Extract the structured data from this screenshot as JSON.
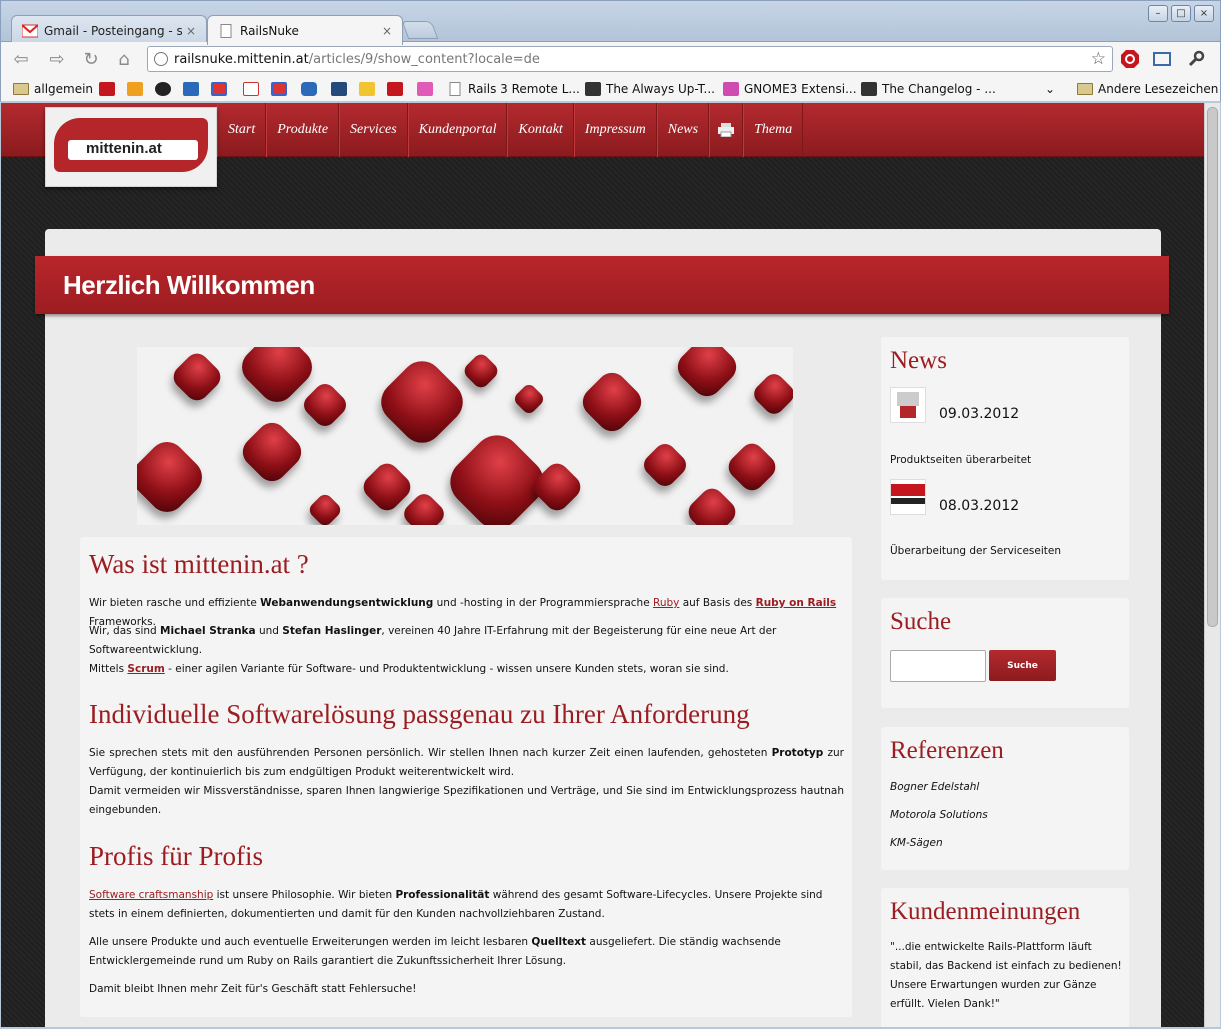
{
  "browser": {
    "tabs": [
      {
        "title": "Gmail - Posteingang - stefa",
        "active": false,
        "icon": "gmail-icon"
      },
      {
        "title": "RailsNuke",
        "active": true,
        "icon": "page-icon"
      }
    ],
    "close_glyph": "×",
    "url_host": "railsnuke.mittenin.at",
    "url_path": "/articles/9/show_content?locale=de",
    "window_buttons": [
      "–",
      "□",
      "×"
    ],
    "bookmarks": [
      {
        "label": "allgemein",
        "icon": "folder-icon"
      },
      {
        "label": "Rails 3 Remote L...",
        "icon": "page-icon"
      },
      {
        "label": "The Always Up-T...",
        "icon": "site-icon"
      },
      {
        "label": "GNOME3 Extensi...",
        "icon": "gnome-icon"
      },
      {
        "label": "The Changelog - ...",
        "icon": "site-icon"
      },
      {
        "label": "Andere Lesezeichen",
        "icon": "folder-icon"
      }
    ]
  },
  "site": {
    "logo_text": "mittenin.at",
    "nav": [
      "Start",
      "Produkte",
      "Services",
      "Kundenportal",
      "Kontakt",
      "Impressum",
      "News",
      "Thema"
    ],
    "welcome_title": "Herzlich Willkommen",
    "section1_title": "Was ist mittenin.at ?",
    "p1": {
      "a": "Wir bieten rasche und effiziente ",
      "b": "Webanwendungsentwicklung",
      "c": " und -hosting in der Programmiersprache ",
      "link1": "Ruby",
      "d": " auf Basis des ",
      "link2": "Ruby on Rails",
      "e": " Frameworks."
    },
    "p2": {
      "a": "Wir, das sind ",
      "b": "Michael Stranka",
      "c": " und ",
      "d": "Stefan Haslinger",
      "e": ", vereinen 40 Jahre IT-Erfahrung mit der Begeisterung für eine neue Art der Softwareentwicklung.",
      "f": "Mittels ",
      "link": "Scrum",
      "g": " - einer agilen Variante für Software- und Produktentwicklung - wissen unsere Kunden stets, woran sie sind."
    },
    "section2_title": "Individuelle Softwarelösung passgenau zu Ihrer Anforderung",
    "p3": {
      "a": "Sie sprechen stets mit den ausführenden Personen persönlich. Wir stellen Ihnen nach kurzer Zeit einen laufenden, gehosteten ",
      "b": "Prototyp",
      "c": " zur Verfügung, der kontinuierlich bis zum endgültigen Produkt weiterentwickelt wird.",
      "d": "Damit vermeiden wir Missverständnisse, sparen Ihnen langwierige Spezifikationen und Verträge, und Sie sind im Entwicklungsprozess hautnah eingebunden."
    },
    "section3_title": "Profis für Profis",
    "p4": {
      "link": "Software craftsmanship",
      "a": " ist unsere Philosophie. Wir bieten ",
      "b": "Professionalität",
      "c": " während des gesamt Software-Lifecycles. Unsere Projekte sind stets in einem definierten, dokumentierten und damit für den Kunden nachvollziehbaren Zustand."
    },
    "p5": {
      "a": "Alle unsere Produkte und auch eventuelle Erweiterungen werden im leicht lesbaren ",
      "b": "Quelltext",
      "c": " ausgeliefert. Die ständig wachsende Entwicklergemeinde rund um Ruby on Rails garantiert die Zukunftssicherheit Ihrer Lösung."
    },
    "p6": "Damit bleibt Ihnen mehr Zeit für's Geschäft statt Fehlersuche!",
    "sidebar": {
      "news_title": "News",
      "news": [
        {
          "date": "09.03.2012",
          "text": "Produktseiten überarbeitet"
        },
        {
          "date": "08.03.2012",
          "text": "Überarbeitung der Serviceseiten"
        }
      ],
      "search_title": "Suche",
      "search_button": "Suche",
      "search_value": "",
      "refs_title": "Referenzen",
      "refs": [
        "Bogner Edelstahl",
        "Motorola Solutions",
        "KM-Sägen"
      ],
      "opinions_title": "Kundenmeinungen",
      "opinion": "\"...die entwickelte Rails-Plattform läuft stabil, das Backend ist einfach zu bedienen! Unsere Erwartungen wurden zur Gänze erfüllt. Vielen Dank!\""
    }
  },
  "colors": {
    "brand_red": "#9b1d21",
    "nav_red": "#b42a2f"
  }
}
